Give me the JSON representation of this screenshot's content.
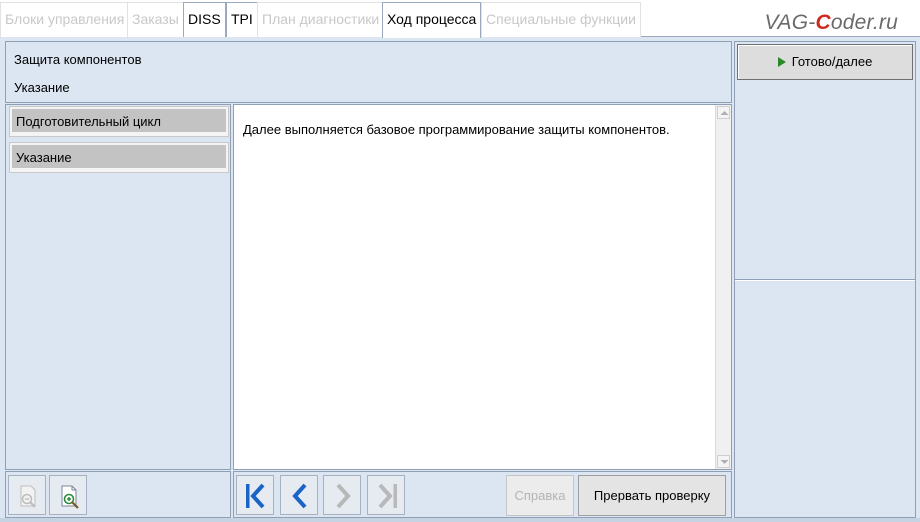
{
  "tabs": [
    {
      "label": "Блоки управления",
      "state": "disabled"
    },
    {
      "label": "Заказы",
      "state": "disabled"
    },
    {
      "label": "DISS",
      "state": "enabled"
    },
    {
      "label": "TPI",
      "state": "enabled"
    },
    {
      "label": "План диагностики",
      "state": "disabled"
    },
    {
      "label": "Ход процесса",
      "state": "active"
    },
    {
      "label": "Специальные функции",
      "state": "disabled"
    }
  ],
  "logo": {
    "pre": "VAG-",
    "accent": "C",
    "post": "oder.ru"
  },
  "header": {
    "title": "Защита компонентов",
    "subtitle": "Указание"
  },
  "steps": [
    {
      "label": "Подготовительный цикл"
    },
    {
      "label": "Указание"
    }
  ],
  "content": {
    "text": "Далее выполняется базовое программирование защиты компонентов."
  },
  "right_panel": {
    "ready_label": "Готово/далее"
  },
  "bottom": {
    "help_label": "Справка",
    "abort_label": "Прервать проверку"
  },
  "icons": {
    "zoom_out": "zoom-out-icon",
    "zoom_in": "zoom-in-icon",
    "first": "skip-first-icon",
    "prev": "chevron-left-icon",
    "next": "chevron-right-icon",
    "last": "skip-last-icon"
  },
  "colors": {
    "background": "#dce6f2",
    "nav_active": "#1a64c8",
    "nav_disabled": "#b8b8b8",
    "play_green": "#2a8a2a",
    "logo_red": "#cf2a1f"
  }
}
